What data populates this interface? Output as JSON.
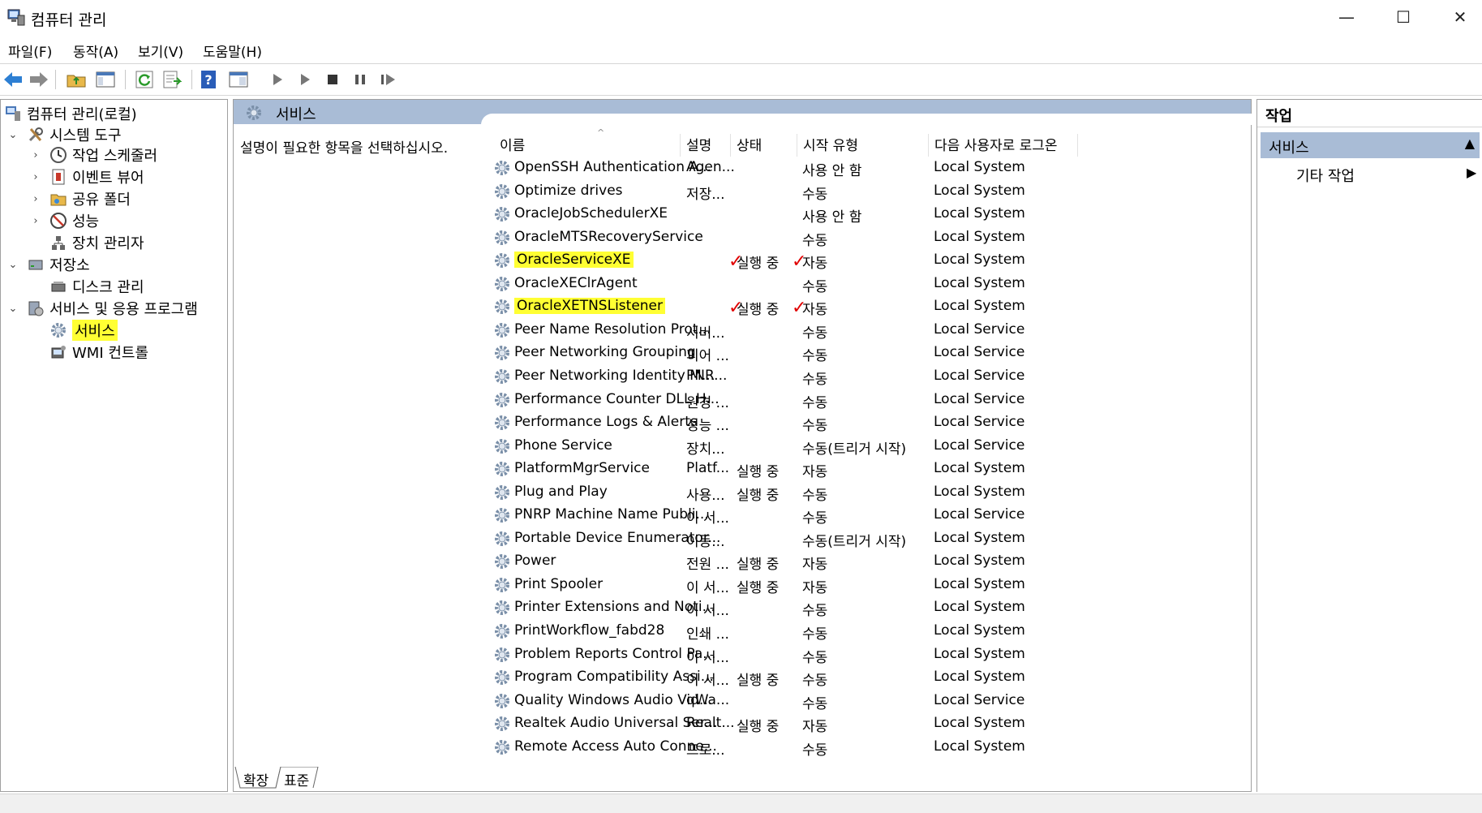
{
  "window": {
    "title": "컴퓨터 관리",
    "minimize": "—",
    "maximize": "☐",
    "close": "✕"
  },
  "menu": [
    "파일(F)",
    "동작(A)",
    "보기(V)",
    "도움말(H)"
  ],
  "tree": {
    "root": "컴퓨터 관리(로컬)",
    "system_tools": "시스템 도구",
    "task_scheduler": "작업 스케줄러",
    "event_viewer": "이벤트 뷰어",
    "shared_folders": "공유 폴더",
    "performance": "성능",
    "device_manager": "장치 관리자",
    "storage": "저장소",
    "disk_management": "디스크 관리",
    "services_apps": "서비스 및 응용 프로그램",
    "services": "서비스",
    "wmi": "WMI 컨트롤"
  },
  "center": {
    "title": "서비스",
    "description_prompt": "설명이 필요한 항목을 선택하십시오.",
    "columns": {
      "name": "이름",
      "desc": "설명",
      "status": "상태",
      "startup": "시작 유형",
      "logon": "다음 사용자로 로그온"
    },
    "tabs": [
      "확장",
      "표준"
    ]
  },
  "services": [
    {
      "name": "OpenSSH Authentication A...",
      "desc": "Agen...",
      "status": "",
      "startup": "사용 안 함",
      "logon": "Local System",
      "highlight": false
    },
    {
      "name": "Optimize drives",
      "desc": "저장...",
      "status": "",
      "startup": "수동",
      "logon": "Local System",
      "highlight": false
    },
    {
      "name": "OracleJobSchedulerXE",
      "desc": "",
      "status": "",
      "startup": "사용 안 함",
      "logon": "Local System",
      "highlight": false
    },
    {
      "name": "OracleMTSRecoveryService",
      "desc": "",
      "status": "",
      "startup": "수동",
      "logon": "Local System",
      "highlight": false
    },
    {
      "name": "OracleServiceXE",
      "desc": "",
      "status": "실행 중",
      "startup": "자동",
      "logon": "Local System",
      "highlight": true
    },
    {
      "name": "OracleXEClrAgent",
      "desc": "",
      "status": "",
      "startup": "수동",
      "logon": "Local System",
      "highlight": false
    },
    {
      "name": "OracleXETNSListener",
      "desc": "",
      "status": "실행 중",
      "startup": "자동",
      "logon": "Local System",
      "highlight": true
    },
    {
      "name": "Peer Name Resolution Prot...",
      "desc": "서버...",
      "status": "",
      "startup": "수동",
      "logon": "Local Service",
      "highlight": false
    },
    {
      "name": "Peer Networking Grouping",
      "desc": "피어 ...",
      "status": "",
      "startup": "수동",
      "logon": "Local Service",
      "highlight": false
    },
    {
      "name": "Peer Networking Identity M...",
      "desc": "PNR...",
      "status": "",
      "startup": "수동",
      "logon": "Local Service",
      "highlight": false
    },
    {
      "name": "Performance Counter DLL H...",
      "desc": "원경 ...",
      "status": "",
      "startup": "수동",
      "logon": "Local Service",
      "highlight": false
    },
    {
      "name": "Performance Logs & Alerts",
      "desc": "성능 ...",
      "status": "",
      "startup": "수동",
      "logon": "Local Service",
      "highlight": false
    },
    {
      "name": "Phone Service",
      "desc": "장치...",
      "status": "",
      "startup": "수동(트리거 시작)",
      "logon": "Local Service",
      "highlight": false
    },
    {
      "name": "PlatformMgrService",
      "desc": "Platf...",
      "status": "실행 중",
      "startup": "자동",
      "logon": "Local System",
      "highlight": false
    },
    {
      "name": "Plug and Play",
      "desc": "사용...",
      "status": "실행 중",
      "startup": "수동",
      "logon": "Local System",
      "highlight": false
    },
    {
      "name": "PNRP Machine Name Publi...",
      "desc": "이 서...",
      "status": "",
      "startup": "수동",
      "logon": "Local Service",
      "highlight": false
    },
    {
      "name": "Portable Device Enumerator...",
      "desc": "이동...",
      "status": "",
      "startup": "수동(트리거 시작)",
      "logon": "Local System",
      "highlight": false
    },
    {
      "name": "Power",
      "desc": "전원 ...",
      "status": "실행 중",
      "startup": "자동",
      "logon": "Local System",
      "highlight": false
    },
    {
      "name": "Print Spooler",
      "desc": "이 서...",
      "status": "실행 중",
      "startup": "자동",
      "logon": "Local System",
      "highlight": false
    },
    {
      "name": "Printer Extensions and Noti...",
      "desc": "이 서...",
      "status": "",
      "startup": "수동",
      "logon": "Local System",
      "highlight": false
    },
    {
      "name": "PrintWorkflow_fabd28",
      "desc": "인쇄 ...",
      "status": "",
      "startup": "수동",
      "logon": "Local System",
      "highlight": false
    },
    {
      "name": "Problem Reports Control Pa...",
      "desc": "이 서...",
      "status": "",
      "startup": "수동",
      "logon": "Local System",
      "highlight": false
    },
    {
      "name": "Program Compatibility Assi...",
      "desc": "이 서...",
      "status": "실행 중",
      "startup": "수동",
      "logon": "Local System",
      "highlight": false
    },
    {
      "name": "Quality Windows Audio Vid...",
      "desc": "qWa...",
      "status": "",
      "startup": "수동",
      "logon": "Local Service",
      "highlight": false
    },
    {
      "name": "Realtek Audio Universal Ser...",
      "desc": "Realt...",
      "status": "실행 중",
      "startup": "자동",
      "logon": "Local System",
      "highlight": false
    },
    {
      "name": "Remote Access Auto Conne...",
      "desc": "프로...",
      "status": "",
      "startup": "수동",
      "logon": "Local System",
      "highlight": false
    }
  ],
  "actions": {
    "header": "작업",
    "section": "서비스",
    "more": "기타 작업"
  },
  "colors": {
    "header_blue": "#a9bcd6",
    "highlight_yellow": "#ffff33",
    "check_red": "#e00000"
  }
}
